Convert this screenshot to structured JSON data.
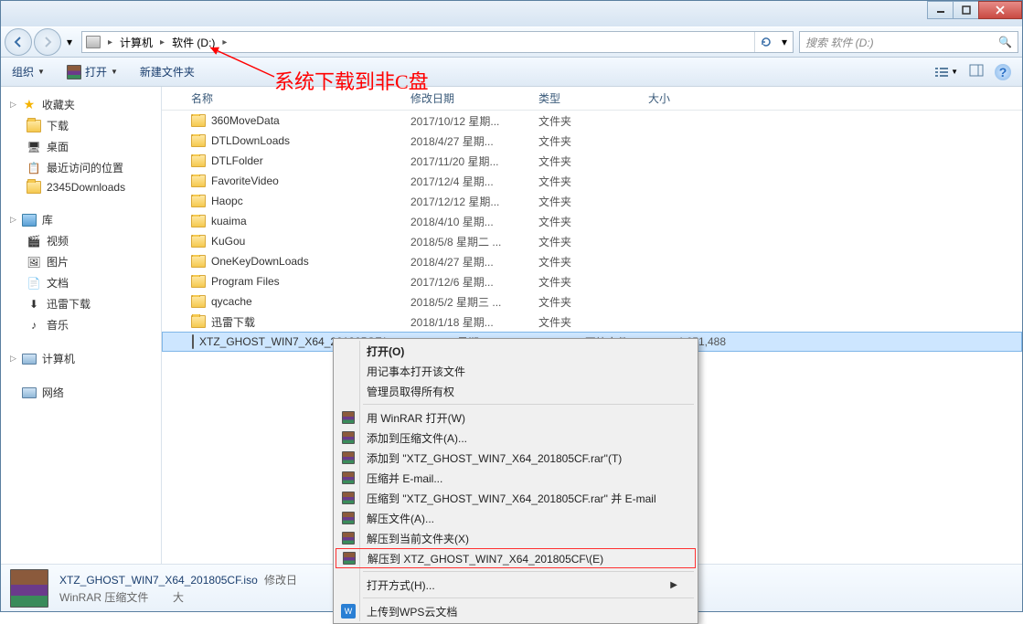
{
  "window": {
    "min": "–",
    "max": "❐",
    "close": "✕"
  },
  "nav": {
    "breadcrumbs": [
      "计算机",
      "软件 (D:)"
    ],
    "search_placeholder": "搜索 软件 (D:)"
  },
  "toolbar": {
    "organize": "组织",
    "open": "打开",
    "new_folder": "新建文件夹"
  },
  "annotation": "系统下载到非C盘",
  "sidebar": {
    "favorites": {
      "label": "收藏夹",
      "items": [
        "下载",
        "桌面",
        "最近访问的位置",
        "2345Downloads"
      ]
    },
    "libs": {
      "label": "库",
      "items": [
        "视频",
        "图片",
        "文档",
        "迅雷下载",
        "音乐"
      ]
    },
    "computer": "计算机",
    "network": "网络"
  },
  "columns": {
    "name": "名称",
    "date": "修改日期",
    "type": "类型",
    "size": "大小"
  },
  "files": [
    {
      "name": "360MoveData",
      "date": "2017/10/12 星期...",
      "type": "文件夹",
      "size": "",
      "icon": "folder"
    },
    {
      "name": "DTLDownLoads",
      "date": "2018/4/27 星期...",
      "type": "文件夹",
      "size": "",
      "icon": "folder"
    },
    {
      "name": "DTLFolder",
      "date": "2017/11/20 星期...",
      "type": "文件夹",
      "size": "",
      "icon": "folder"
    },
    {
      "name": "FavoriteVideo",
      "date": "2017/12/4 星期...",
      "type": "文件夹",
      "size": "",
      "icon": "folder"
    },
    {
      "name": "Haopc",
      "date": "2017/12/12 星期...",
      "type": "文件夹",
      "size": "",
      "icon": "folder"
    },
    {
      "name": "kuaima",
      "date": "2018/4/10 星期...",
      "type": "文件夹",
      "size": "",
      "icon": "folder"
    },
    {
      "name": "KuGou",
      "date": "2018/5/8 星期二 ...",
      "type": "文件夹",
      "size": "",
      "icon": "folder"
    },
    {
      "name": "OneKeyDownLoads",
      "date": "2018/4/27 星期...",
      "type": "文件夹",
      "size": "",
      "icon": "folder"
    },
    {
      "name": "Program Files",
      "date": "2017/12/6 星期...",
      "type": "文件夹",
      "size": "",
      "icon": "folder"
    },
    {
      "name": "qycache",
      "date": "2018/5/2 星期三 ...",
      "type": "文件夹",
      "size": "",
      "icon": "folder"
    },
    {
      "name": "迅雷下载",
      "date": "2018/1/18 星期...",
      "type": "文件夹",
      "size": "",
      "icon": "folder"
    },
    {
      "name": "XTZ_GHOST_WIN7_X64_201805CF.iso",
      "date": "2018/5/8 星期二",
      "type": "WinRAR 压缩文件",
      "size": "4,651,488",
      "icon": "rar",
      "selected": true
    }
  ],
  "context_menu": [
    {
      "label": "打开(O)",
      "bold": true
    },
    {
      "label": "用记事本打开该文件"
    },
    {
      "label": "管理员取得所有权"
    },
    {
      "sep": true
    },
    {
      "label": "用 WinRAR 打开(W)",
      "icon": "rar"
    },
    {
      "label": "添加到压缩文件(A)...",
      "icon": "rar"
    },
    {
      "label": "添加到 \"XTZ_GHOST_WIN7_X64_201805CF.rar\"(T)",
      "icon": "rar"
    },
    {
      "label": "压缩并 E-mail...",
      "icon": "rar"
    },
    {
      "label": "压缩到 \"XTZ_GHOST_WIN7_X64_201805CF.rar\" 并 E-mail",
      "icon": "rar"
    },
    {
      "label": "解压文件(A)...",
      "icon": "rar"
    },
    {
      "label": "解压到当前文件夹(X)",
      "icon": "rar"
    },
    {
      "label": "解压到 XTZ_GHOST_WIN7_X64_201805CF\\(E)",
      "icon": "rar",
      "hl": true
    },
    {
      "sep": true
    },
    {
      "label": "打开方式(H)...",
      "sub": true
    },
    {
      "sep": true
    },
    {
      "label": "上传到WPS云文档",
      "icon": "wps"
    }
  ],
  "details": {
    "name": "XTZ_GHOST_WIN7_X64_201805CF.iso",
    "meta": "修改日",
    "type": "WinRAR 压缩文件",
    "size_label": "大"
  }
}
